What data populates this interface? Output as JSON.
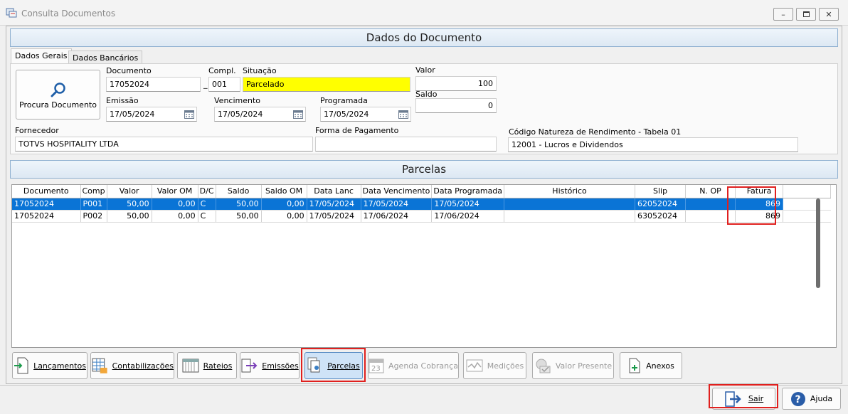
{
  "window": {
    "title": "Consulta Documentos"
  },
  "document_section": {
    "title": "Dados do Documento"
  },
  "tabs": [
    "Dados Gerais",
    "Dados Bancários"
  ],
  "search_button": {
    "label": "Procura Documento"
  },
  "fields": {
    "documento": {
      "label": "Documento",
      "value": "17052024"
    },
    "compl": {
      "label": "Compl.",
      "value": "001"
    },
    "separator": "_",
    "situacao": {
      "label": "Situação",
      "value": "Parcelado"
    },
    "valor": {
      "label": "Valor",
      "value": "100"
    },
    "saldo": {
      "label": "Saldo",
      "value": "0"
    },
    "emissao": {
      "label": "Emissão",
      "value": "17/05/2024"
    },
    "vencimento": {
      "label": "Vencimento",
      "value": "17/05/2024"
    },
    "programada": {
      "label": "Programada",
      "value": "17/05/2024"
    },
    "fornecedor": {
      "label": "Fornecedor",
      "value": "TOTVS HOSPITALITY LTDA"
    },
    "forma_pagamento": {
      "label": "Forma de Pagamento",
      "value": ""
    },
    "natureza": {
      "label": "Código Natureza de Rendimento - Tabela 01",
      "value": "12001 - Lucros e Dividendos"
    }
  },
  "parcelas_section": {
    "title": "Parcelas"
  },
  "grid": {
    "columns": [
      "Documento",
      "Comp",
      "Valor",
      "Valor OM",
      "D/C",
      "Saldo",
      "Saldo OM",
      "Data Lanc",
      "Data Vencimento",
      "Data Programada",
      "Histórico",
      "Slip",
      "N. OP",
      "Fatura"
    ],
    "rows": [
      [
        "17052024",
        "P001",
        "50,00",
        "0,00",
        "C",
        "50,00",
        "0,00",
        "17/05/2024",
        "17/05/2024",
        "17/05/2024",
        "",
        "62052024",
        "",
        "869"
      ],
      [
        "17052024",
        "P002",
        "50,00",
        "0,00",
        "C",
        "50,00",
        "0,00",
        "17/05/2024",
        "17/06/2024",
        "17/06/2024",
        "",
        "63052024",
        "",
        "869"
      ]
    ]
  },
  "toolbar": {
    "lancamentos": "Lançamentos",
    "contabilizacoes": "Contabilizações",
    "rateios": "Rateios",
    "emissoes": "Emissões",
    "parcelas": "Parcelas",
    "agenda": "Agenda Cobrança",
    "medicoes": "Medições",
    "valor_presente": "Valor Presente",
    "anexos": "Anexos"
  },
  "footer": {
    "sair": "Sair",
    "ajuda": "Ajuda"
  },
  "colors": {
    "selection": "#0a74d6",
    "highlight": "#e0201e",
    "situacao_bg": "#ffff00"
  }
}
